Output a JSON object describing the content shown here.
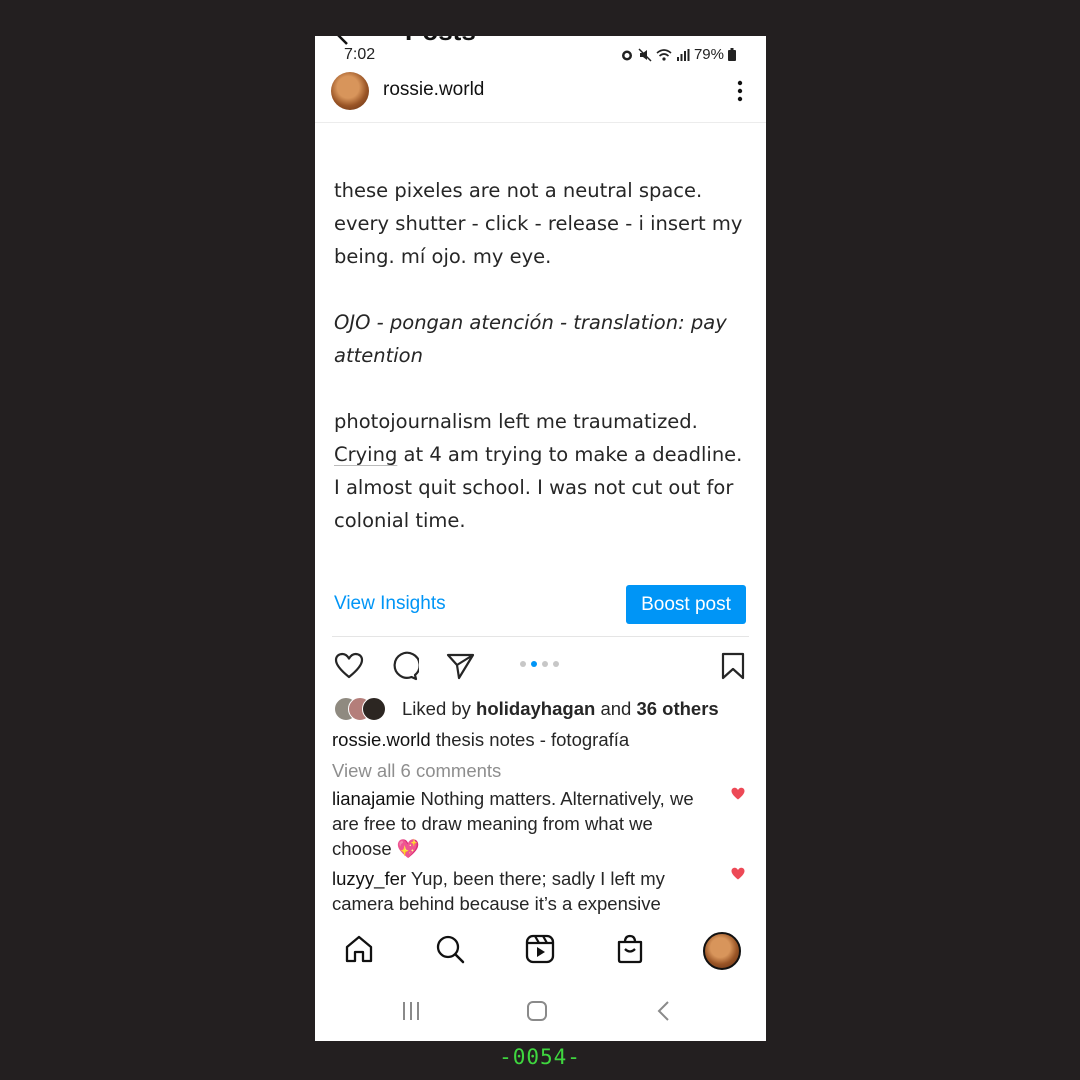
{
  "header": {
    "title": "Posts",
    "username": "rossie.world"
  },
  "status_bar": {
    "time": "7:02",
    "battery": "79%"
  },
  "post": {
    "paragraphs": [
      "these pixeles are not a neutral space.  every shutter - click - release - i insert my being. mí ojo.  my eye.",
      "OJO - pongan atención - translation: pay attention",
      "photojournalism left me traumatized.",
      "at 4 am trying to make a deadline.  I almost quit school. I was not cut out for colonial time."
    ],
    "underlined_word": "Crying",
    "view_insights": "View Insights",
    "boost_post": "Boost post"
  },
  "carousel": {
    "count": 4,
    "active": 1
  },
  "likes": {
    "prefix": "Liked by",
    "user": "holidayhagan",
    "joiner": "and",
    "others": "36 others"
  },
  "caption": {
    "user": "rossie.world",
    "text": "thesis notes - fotografía"
  },
  "view_comments": "View all 6 comments",
  "comments": [
    {
      "user": "lianajamie",
      "text": "Nothing matters. Alternatively, we are free to draw meaning from what we choose 💖"
    },
    {
      "user": "luzyy_fer",
      "text": "Yup, been there; sadly I left my camera behind because it’s a expensive"
    }
  ],
  "colors": {
    "accent": "#0095f6",
    "heart": "#ed4956"
  },
  "frame_label": "-0054-"
}
